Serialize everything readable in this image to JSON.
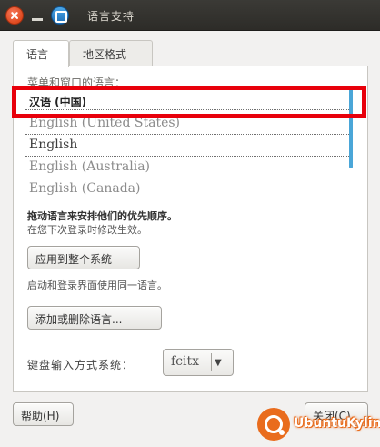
{
  "window": {
    "title": "语言支持"
  },
  "tabs": [
    {
      "label": "语言"
    },
    {
      "label": "地区格式"
    }
  ],
  "languages_label": "菜单和窗口的语言：",
  "languages": [
    "汉语 (中国)",
    "English (United States)",
    "English",
    "English (Australia)",
    "English (Canada)"
  ],
  "hint_bold": "拖动语言来安排他们的优先顺序。",
  "hint_normal": "在您下次登录时修改生效。",
  "apply_button": "应用到整个系统",
  "apply_hint": "启动和登录界面使用同一语言。",
  "add_remove_button": "添加或删除语言...",
  "keyboard": {
    "label": "键盘输入方式系统：",
    "value": "fcitx"
  },
  "help_button": "帮助(H)",
  "close_button": "关闭(C)",
  "colors": {
    "highlight": "#e8000b",
    "accent": "#4aa6d8",
    "logo": "#e96c1d"
  },
  "logo_text": "UbuntuKylin"
}
